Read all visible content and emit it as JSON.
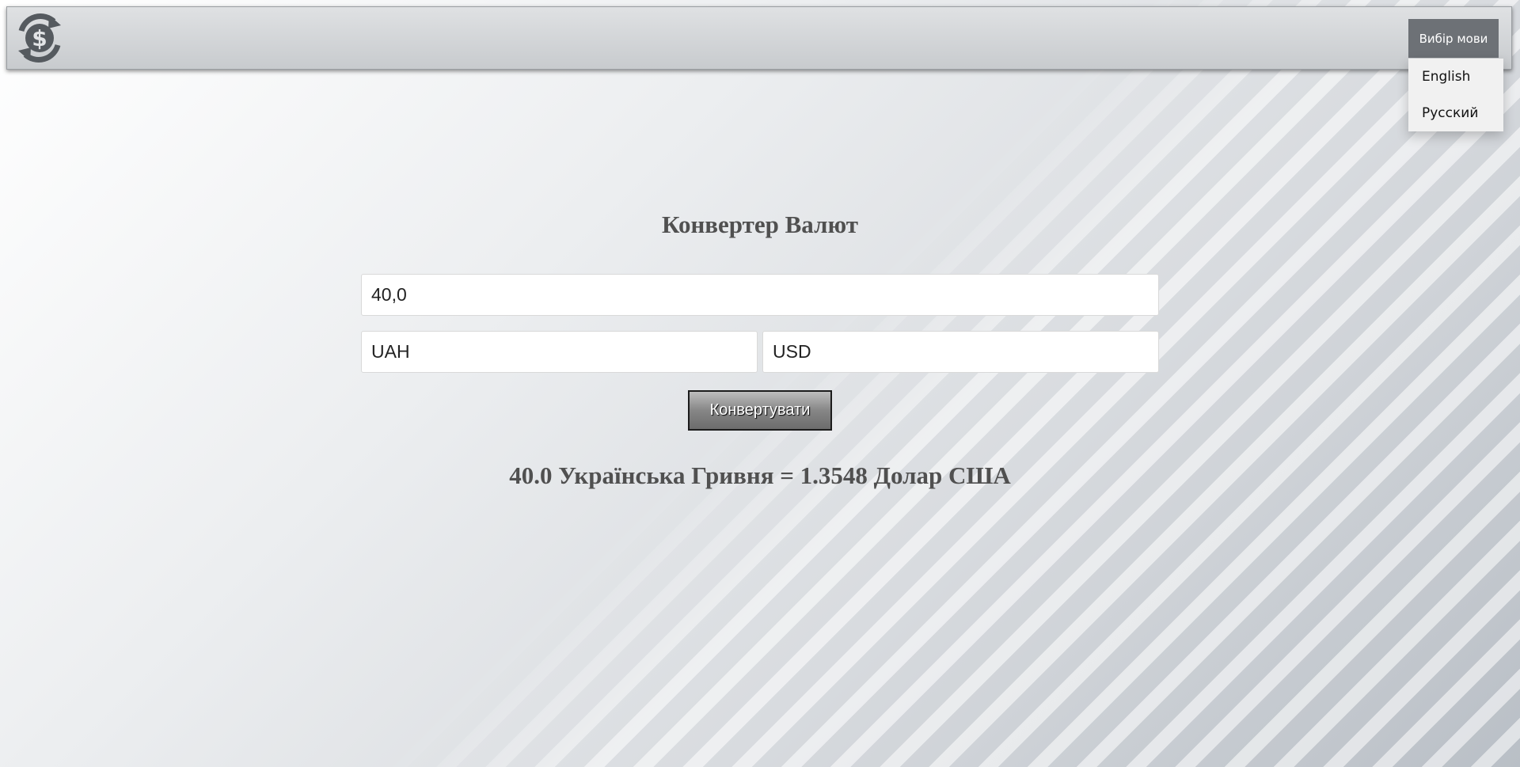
{
  "header": {
    "logo_icon": "dollar-exchange-icon",
    "language_button": "Вибір мови",
    "language_options": [
      "English",
      "Русский"
    ]
  },
  "converter": {
    "title": "Конвертер Валют",
    "amount_value": "40,0",
    "from_currency": "UAH",
    "to_currency": "USD",
    "convert_label": "Конвертувати",
    "result": "40.0 Українська Гривня = 1.3548 Долар США"
  },
  "colors": {
    "text": "#505050",
    "navbar": "#d3d6d9",
    "language_button": "#6d7176"
  }
}
